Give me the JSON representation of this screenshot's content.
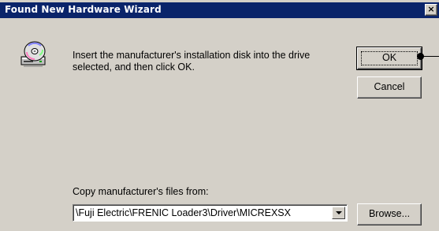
{
  "window": {
    "title": "Found New Hardware Wizard",
    "close_glyph": "×",
    "close_icon": "close-icon",
    "background": "#d4d0c8",
    "titlebar_color": "#0a246a"
  },
  "dialog": {
    "icon": "cd-drive-icon",
    "message": "Insert the manufacturer's installation disk into the drive selected, and then click OK.",
    "copy_label": "Copy manufacturer's files from:",
    "path_value": "\\Fuji Electric\\FRENIC Loader3\\Driver\\MICREXSX",
    "dropdown_icon": "chevron-down-icon"
  },
  "buttons": {
    "ok": "OK",
    "cancel": "Cancel",
    "browse": "Browse..."
  }
}
